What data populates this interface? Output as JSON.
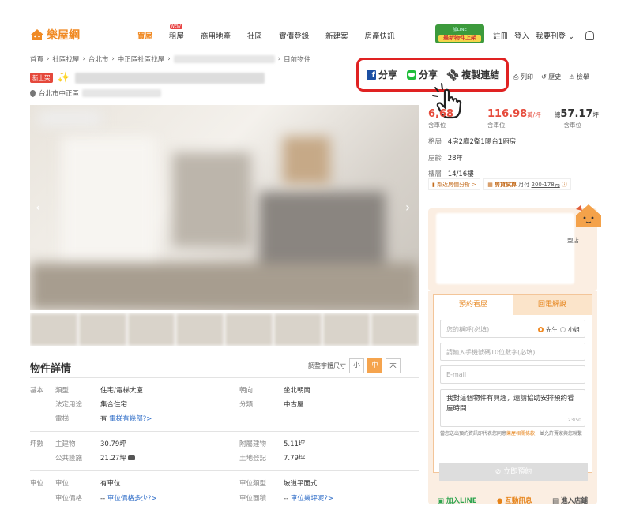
{
  "nav": {
    "logo": "樂屋網",
    "menu": [
      "買屋",
      "租屋",
      "商用地產",
      "社區",
      "實價登錄",
      "新建案",
      "房產快訊"
    ],
    "new_badge": "NEW",
    "line_banner_top": "加LINE",
    "line_banner_bot": "最新物件上架",
    "register": "註冊",
    "login": "登入",
    "post": "我要刊登"
  },
  "breadcrumb": {
    "items": [
      "首頁",
      "社區找屋",
      "台北市",
      "中正區社區找屋"
    ],
    "current": "目前物件"
  },
  "listing": {
    "new_badge": "新上架",
    "location": "台北市中正區"
  },
  "share": {
    "fb": "分享",
    "line": "分享",
    "copy": "複製連結"
  },
  "tools": [
    "列印",
    "歷史",
    "檢舉"
  ],
  "price": {
    "total": "6,68",
    "total_label": "含車位",
    "unit_price": "116.98",
    "unit_suffix": "萬/坪",
    "unit_label": "含車位",
    "area_prefix": "總",
    "area": "57.17",
    "area_suffix": "坪",
    "area_label": "含車位"
  },
  "specs": {
    "layout_key": "格局",
    "layout": "4房2廳2衛1陽台1廚房",
    "age_key": "屋齡",
    "age": "28年",
    "floor_key": "樓層",
    "floor": "14/16樓"
  },
  "analysis": {
    "price_btn": "鄰近房價分析 >",
    "loan_label": "房貸試算",
    "monthly": "月付",
    "monthly_val": "200-178元"
  },
  "agent": {
    "shop": "盟店"
  },
  "form": {
    "tab_appointment": "預約看屋",
    "tab_callback": "回電解說",
    "name_placeholder": "您的稱呼(必填)",
    "gender_mr": "先生",
    "gender_ms": "小姐",
    "phone_placeholder": "請輸入手機號碼10位數字(必填)",
    "email_placeholder": "E-mail",
    "message": "我對這個物件有興趣，還請協助安排預約看屋時間！",
    "counter": "23/50",
    "note_pre": "當您送出預約資訊即代表您同意",
    "note_link": "樂屋相關條款",
    "note_post": "，並允許賣家與您聯繫",
    "submit": "立即預約"
  },
  "footer_bar": {
    "line": "加入LINE",
    "chat": "互動訊息",
    "shop": "進入店鋪"
  },
  "details": {
    "title": "物件詳情",
    "font_size_label": "調整字體尺寸",
    "sizes": [
      "小",
      "中",
      "大"
    ],
    "basic_section": "基本",
    "type_key": "類型",
    "type_val": "住宅/電梯大廈",
    "legal_key": "法定用途",
    "legal_val": "集合住宅",
    "elevator_key": "電梯",
    "elevator_val": "有",
    "elevator_link": "電梯有幾部?>",
    "facing_key": "朝向",
    "facing_val": "坐北朝南",
    "category_key": "分類",
    "category_val": "中古屋",
    "area_section": "坪數",
    "main_key": "主建物",
    "main_val": "30.79坪",
    "public_key": "公共設施",
    "public_val": "21.27坪",
    "attached_key": "附屬建物",
    "attached_val": "5.11坪",
    "land_key": "土地登記",
    "land_val": "7.79坪",
    "parking_section": "車位",
    "parking_key": "車位",
    "parking_val": "有車位",
    "parking_price_key": "車位價格",
    "parking_price_val": "--",
    "parking_price_link": "車位價格多少?>",
    "parking_type_key": "車位類型",
    "parking_type_val": "坡道平面式",
    "parking_area_key": "車位面積",
    "parking_area_val": "--",
    "parking_area_link": "車位幾坪呢?>"
  }
}
